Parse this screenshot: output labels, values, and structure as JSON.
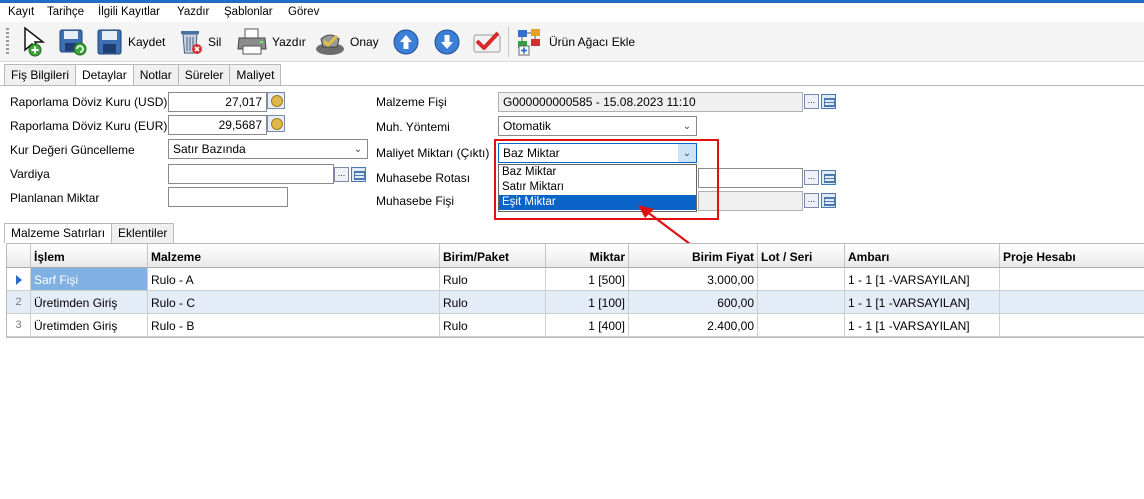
{
  "menu": [
    "Kayıt",
    "Tarihçe",
    "İlgili Kayıtlar",
    "Yazdır",
    "Şablonlar",
    "Görev"
  ],
  "toolbar": {
    "kaydet": "Kaydet",
    "sil": "Sil",
    "yazdir": "Yazdır",
    "onay": "Onay",
    "urun_agaci": "Ürün Ağacı Ekle"
  },
  "tabs": [
    "Fiş Bilgileri",
    "Detaylar",
    "Notlar",
    "Süreler",
    "Maliyet"
  ],
  "active_tab": "Detaylar",
  "form": {
    "usd_label": "Raporlama Döviz Kuru (USD)",
    "usd_value": "27,017",
    "eur_label": "Raporlama Döviz Kuru (EUR)",
    "eur_value": "29,5687",
    "kur_label": "Kur Değeri Güncelleme",
    "kur_value": "Satır Bazında",
    "vardiya_label": "Vardiya",
    "vardiya_value": "",
    "planlanan_label": "Planlanan Miktar",
    "planlanan_value": "",
    "malzeme_fisi_label": "Malzeme Fişi",
    "malzeme_fisi_value": "G000000000585 - 15.08.2023 11:10",
    "muh_yontemi_label": "Muh. Yöntemi",
    "muh_yontemi_value": "Otomatik",
    "maliyet_miktari_label": "Maliyet Miktarı (Çıktı)",
    "maliyet_miktari_value": "Baz Miktar",
    "muhasebe_rotasi_label": "Muhasebe Rotası",
    "muhasebe_fisi_label": "Muhasebe Fişi"
  },
  "dropdown_options": [
    "Baz Miktar",
    "Satır Miktarı",
    "Eşit Miktar"
  ],
  "dropdown_selected_index": 2,
  "bottom_tabs": [
    "Malzeme Satırları",
    "Eklentiler"
  ],
  "grid": {
    "headers": [
      "İşlem",
      "Malzeme",
      "Birim/Paket",
      "Miktar",
      "Birim Fiyat",
      "Lot / Seri",
      "Ambarı",
      "Proje Hesabı"
    ],
    "rows": [
      {
        "no": "",
        "islem": "Sarf Fişi",
        "malzeme": "Rulo - A",
        "birim": "Rulo",
        "miktar": "1 [500]",
        "fiyat": "3.000,00",
        "lot": "",
        "ambar": "1 - 1 [1 -VARSAYILAN]",
        "proje": ""
      },
      {
        "no": "2",
        "islem": "Üretimden Giriş",
        "malzeme": "Rulo - C",
        "birim": "Rulo",
        "miktar": "1 [100]",
        "fiyat": "600,00",
        "lot": "",
        "ambar": "1 - 1 [1 -VARSAYILAN]",
        "proje": ""
      },
      {
        "no": "3",
        "islem": "Üretimden Giriş",
        "malzeme": "Rulo - B",
        "birim": "Rulo",
        "miktar": "1 [400]",
        "fiyat": "2.400,00",
        "lot": "",
        "ambar": "1 - 1 [1 -VARSAYILAN]",
        "proje": ""
      }
    ]
  },
  "colors": {
    "accent": "#1f6fc5",
    "selection": "#0a64c8",
    "highlight_box": "#e01010",
    "row_alt": "#e4ecf7"
  }
}
